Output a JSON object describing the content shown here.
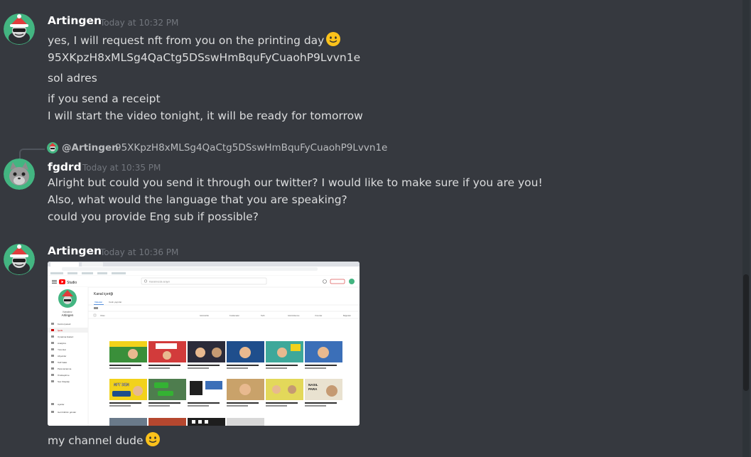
{
  "messages": [
    {
      "author": "Artingen",
      "timestamp": "Today at 10:32 PM",
      "lines": [
        "yes, I will request nft from you on the printing day",
        "95XKpzH8xMLSg4QaCtg5DSswHmBquFyCuaohP9Lvvn1e",
        "sol adres",
        "if you send a receipt",
        "I will start the video tonight, it will be ready for tomorrow"
      ],
      "emoji": "slightly-smiling-face"
    },
    {
      "reply": {
        "mention": "@Artingen",
        "text": "95XKpzH8xMLSg4QaCtg5DSswHmBquFyCuaohP9Lvvn1e"
      },
      "author": "fgdrd",
      "timestamp": "Today at 10:35 PM",
      "lines": [
        "Alright but could you send it through our twitter? I would like to make sure if you are you!",
        "Also, what would the language that you are speaking?",
        "could you provide Eng sub if possible?"
      ]
    },
    {
      "author": "Artingen",
      "timestamp": "Today at 10:36 PM",
      "attachment": {
        "type": "screenshot",
        "app": "Studio",
        "search_placeholder": "Kanalınızda arayın",
        "page_title": "Kanal içeriği",
        "channel_name": "Artingen",
        "channel_label": "Kanalınız",
        "tabs": [
          "Videolar",
          "Canlı yayınlar"
        ],
        "columns": [
          "Video",
          "Görünürlük",
          "Kısıtlamalar",
          "Tarih",
          "Görüntülenme",
          "Yorumlar",
          "Beğeniler"
        ],
        "sidebar": [
          "Kontrol paneli",
          "İçerik",
          "Oynatma listeleri",
          "Analytics",
          "Yorumlar",
          "Altyazılar",
          "Telif hakkı",
          "Para kazanma",
          "Özelleştirme",
          "Ses Kitaplığı",
          "Ayarlar",
          "Geri bildirim gönder"
        ],
        "thumb_labels": [
          "NFT DEN",
          "NASIL",
          "PARA"
        ]
      },
      "lines": [
        "my channel dude"
      ],
      "emoji": "slightly-smiling-face"
    }
  ],
  "colors": {
    "background": "#36393f",
    "text": "#dcddde",
    "username": "#ffffff",
    "timestamp": "#72767d",
    "emoji": "#fcc21b"
  }
}
